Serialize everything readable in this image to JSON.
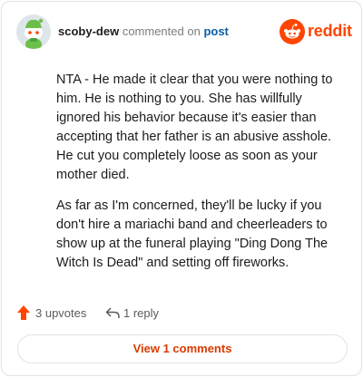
{
  "comment": {
    "username": "scoby-dew",
    "commented_text": "commented on",
    "post_link": "post",
    "brand": "reddit",
    "paragraphs": [
      "NTA - He made it clear that you were nothing to him. He is nothing to you. She has willfully ignored his behavior because it's easier than accepting that her father is an abusive asshole. He cut you completely loose as soon as your mother died.",
      "As far as I'm concerned, they'll be lucky if you don't hire a mariachi band and cheerleaders to show up at the funeral playing \"Ding Dong The Witch Is Dead\" and setting off fireworks."
    ]
  },
  "actions": {
    "upvotes_label": "3 upvotes",
    "reply_label": "1 reply"
  },
  "footer": {
    "view_comments_label": "View 1 comments"
  },
  "colors": {
    "accent": "#ff4500",
    "link": "#0a5fa7",
    "button_text": "#d93a00"
  },
  "icons": {
    "avatar": "snoo-avatar-icon",
    "brand": "reddit-logo-icon",
    "upvote": "upvote-arrow-icon",
    "reply": "reply-arrow-icon"
  }
}
